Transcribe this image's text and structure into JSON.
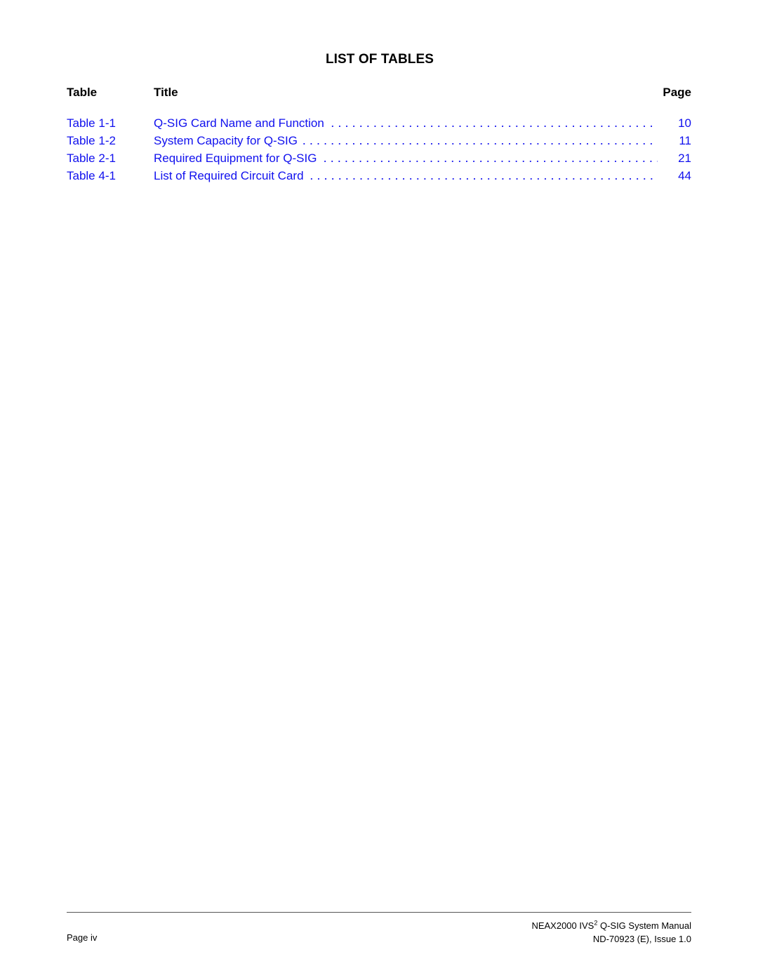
{
  "page": {
    "title": "LIST OF TABLES",
    "link_color": "#1010ee"
  },
  "columns": {
    "table": "Table",
    "title": "Title",
    "page": "Page"
  },
  "entries": [
    {
      "number": "Table 1-1",
      "title": "Q-SIG Card Name and Function",
      "page": "10"
    },
    {
      "number": "Table 1-2",
      "title": "System Capacity for Q-SIG",
      "page": "11"
    },
    {
      "number": "Table 2-1",
      "title": "Required Equipment for Q-SIG",
      "page": "21"
    },
    {
      "number": "Table 4-1",
      "title": "List of Required Circuit Card",
      "page": "44"
    }
  ],
  "footer": {
    "page_label": "Page iv",
    "manual_prefix": "NEAX2000 IVS",
    "manual_superscript": "2",
    "manual_suffix": " Q-SIG System Manual",
    "document_id": "ND-70923 (E), Issue 1.0"
  }
}
